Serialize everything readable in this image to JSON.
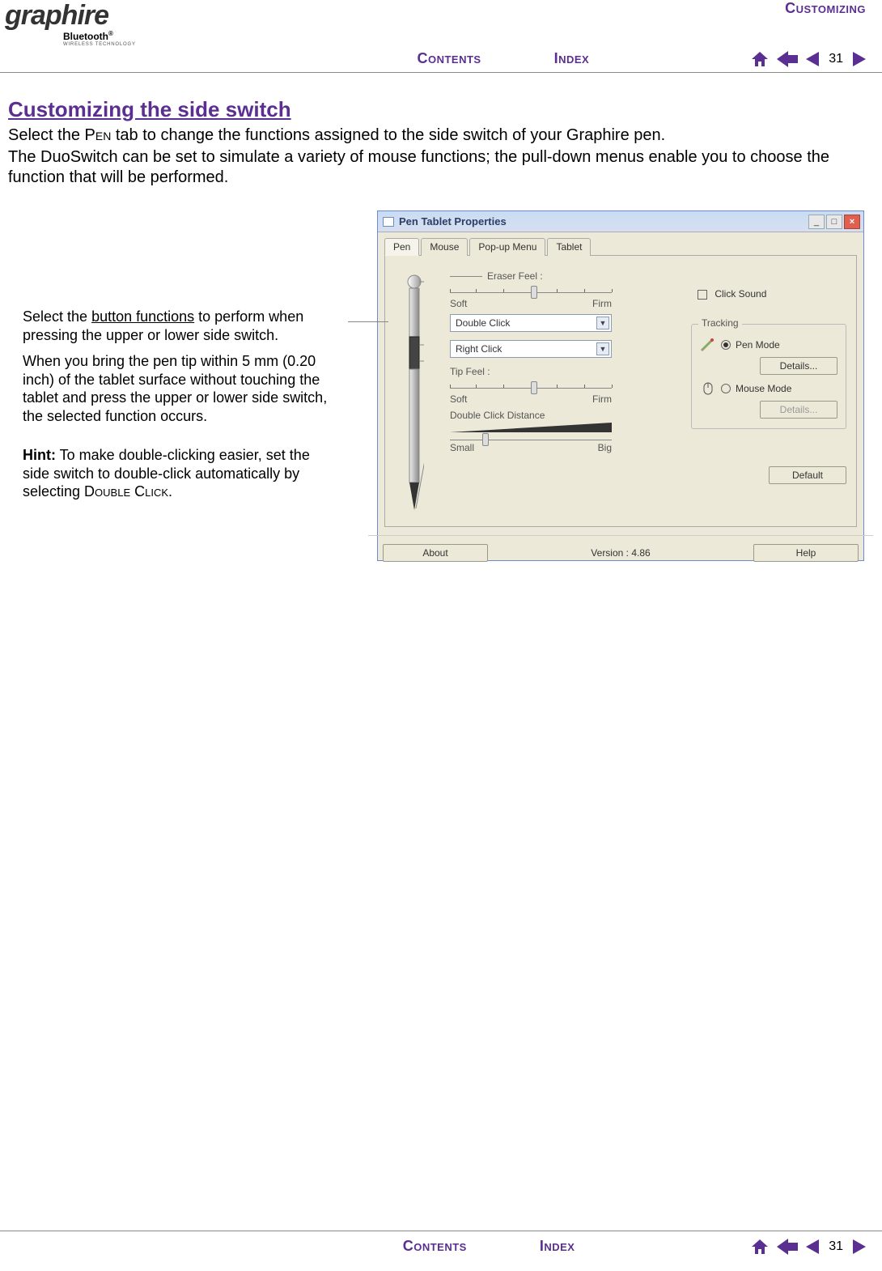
{
  "header": {
    "brand_main": "graphire",
    "brand_sub": "Bluetooth",
    "brand_sub2": "WIRELESS TECHNOLOGY",
    "section": "Customizing",
    "contents": "Contents",
    "index": "Index",
    "page_no": "31"
  },
  "body": {
    "title": "Customizing the side switch",
    "p1a": "Select the ",
    "p1_pen": "Pen",
    "p1b": " tab to change the functions assigned to the side switch of your Graphire pen.",
    "p2": "The DuoSwitch can be set to simulate a variety of mouse functions; the pull-down menus enable you to choose the function that will be performed."
  },
  "callout": {
    "c1a": "Select the ",
    "c1_link": "button functions",
    "c1b": " to perform when pressing  the upper or lower side switch.",
    "c2": "When you bring the pen tip within 5 mm (0.20 inch) of the tablet surface without touching the tablet and press the upper or lower side switch, the selected function occurs.",
    "hint_label": "Hint:",
    "hint_a": " To make double-clicking easier, set the side switch to double-click automatically by selecting ",
    "hint_caps": "Double Click",
    "hint_end": "."
  },
  "dialog": {
    "title": "Pen Tablet Properties",
    "tabs": [
      "Pen",
      "Mouse",
      "Pop-up Menu",
      "Tablet"
    ],
    "eraser_label": "Eraser Feel :",
    "soft": "Soft",
    "firm": "Firm",
    "combo_upper": "Double Click",
    "combo_lower": "Right Click",
    "tip_label": "Tip Feel :",
    "dcd_label": "Double Click Distance",
    "small": "Small",
    "big": "Big",
    "click_sound": "Click Sound",
    "tracking": "Tracking",
    "pen_mode": "Pen Mode",
    "mouse_mode": "Mouse Mode",
    "details": "Details...",
    "default": "Default",
    "about": "About",
    "version": "Version : 4.86",
    "help": "Help"
  },
  "footer": {
    "contents": "Contents",
    "index": "Index",
    "page_no": "31"
  },
  "colors": {
    "accent": "#5b2e91"
  }
}
